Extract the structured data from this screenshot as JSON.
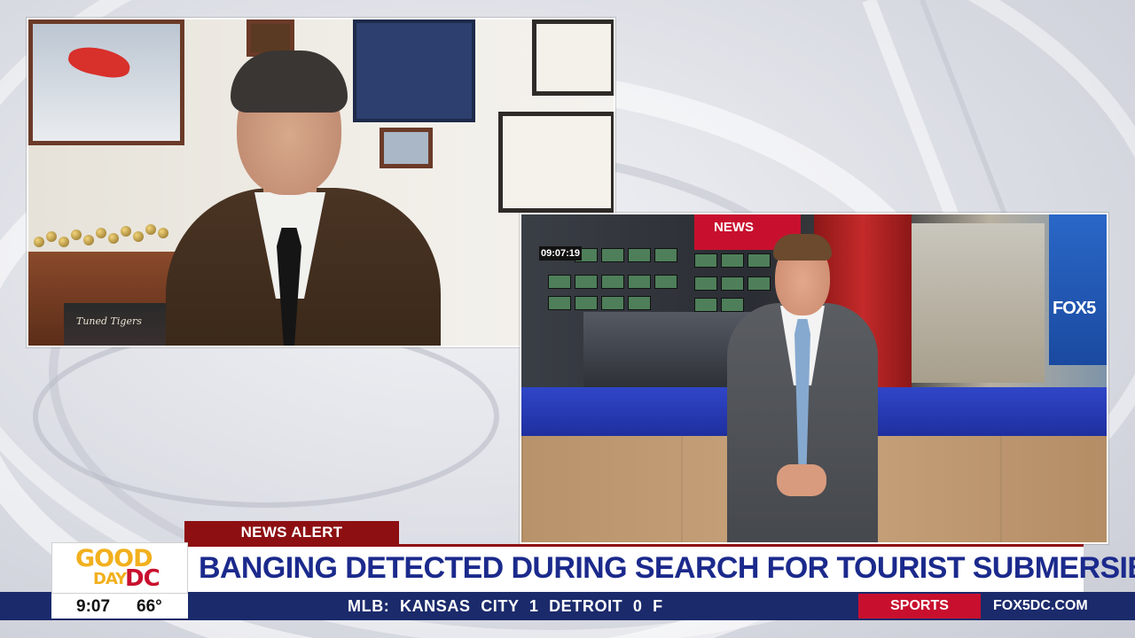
{
  "lower_third": {
    "alert_label": "NEWS ALERT",
    "headline": "BANGING DETECTED DURING SEARCH FOR TOURIST SUBMERSIBLE"
  },
  "logo": {
    "good": "GOOD",
    "day": "DAY",
    "dc": "DC"
  },
  "weather": {
    "time": "9:07",
    "temp": "66°"
  },
  "ticker": {
    "text": "MLB:  KANSAS CITY  1  DETROIT  0  F"
  },
  "sports_label": "SPORTS",
  "website": "FOX5DC.COM",
  "newsroom": {
    "breaking_sign": "NEWS",
    "clock": "09:07:19",
    "screen_logo": "FOX5"
  },
  "guest_office": {
    "book_title": "Tuned Tigers"
  },
  "colors": {
    "headline_blue": "#1b2a8c",
    "alert_red": "#8d0f12",
    "ticker_navy": "#1b2a6b",
    "logo_gold": "#f2b01e",
    "logo_red": "#c8102e"
  }
}
